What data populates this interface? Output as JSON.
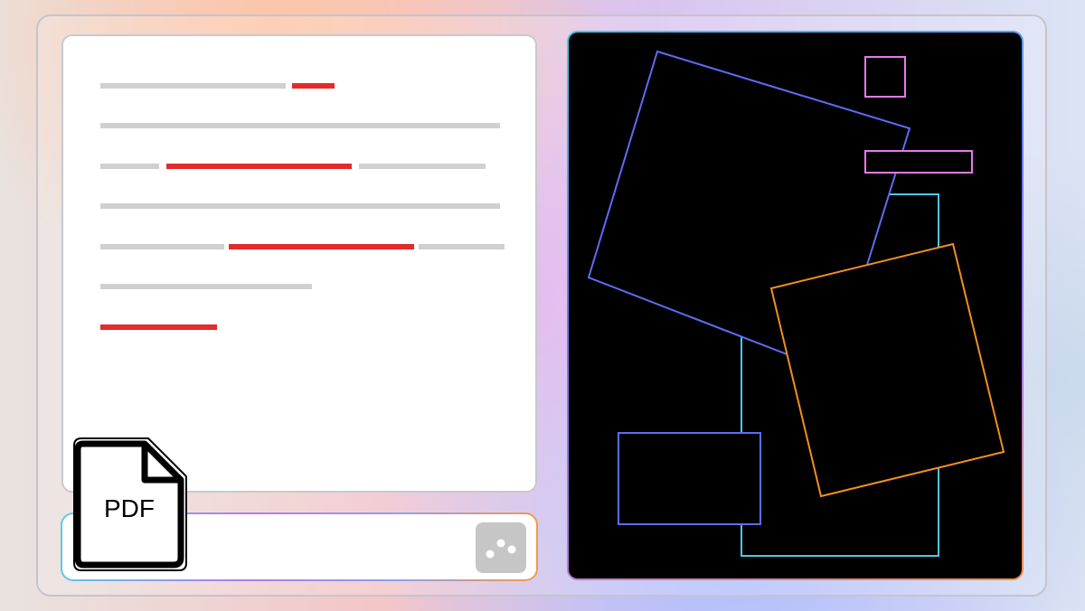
{
  "attachment": {
    "type_label": "PDF"
  },
  "prompt_input": {
    "value": "",
    "placeholder": ""
  },
  "colors": {
    "text_line_gray": "#d0d0d0",
    "highlight_red": "#e32b2b",
    "canvas_background": "#000000",
    "outline_blue": "#5a6ef5",
    "outline_cyan": "#4cc7e6",
    "outline_pink": "#e878f0",
    "outline_orange": "#f09020",
    "send_button_gray": "#c6c6c6"
  },
  "icons": {
    "attachment": "pdf-file-icon",
    "send": "three-dots-icon"
  }
}
